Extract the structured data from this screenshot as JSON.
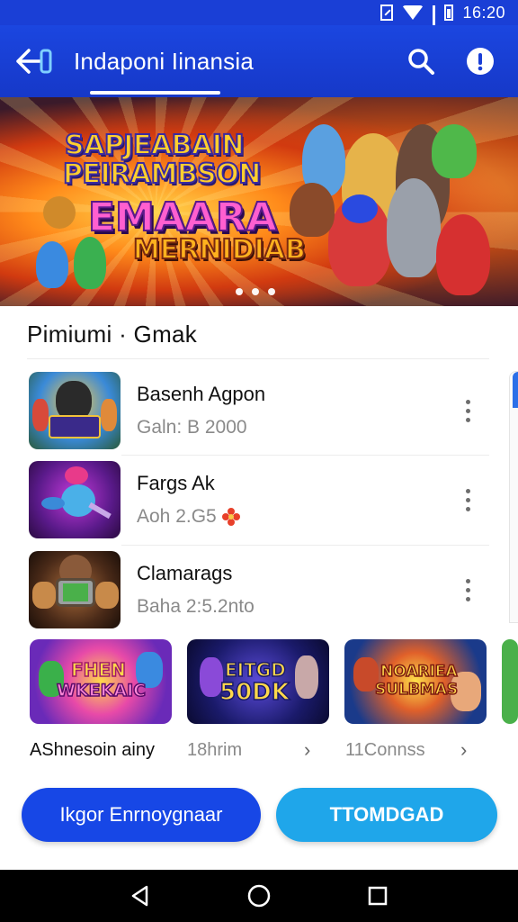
{
  "status_bar": {
    "time": "16:20",
    "icons": [
      "sim-icon",
      "wifi-icon",
      "signal-icon",
      "battery-icon"
    ]
  },
  "app_bar": {
    "title": "Indaponi Iinansia",
    "back_icon": "back-arrow-icon",
    "search_icon": "search-icon",
    "info_icon": "info-icon"
  },
  "banner": {
    "line1": "SAPJEABAIN",
    "line2": "PEIRAMBSON",
    "line3": "EMAARA",
    "line4": "MERNIDIAB",
    "pages": 3
  },
  "section": {
    "title": "Pimiumi · Gmak"
  },
  "list": [
    {
      "title": "Basenh Agpon",
      "subtitle": "Galn: B 2000"
    },
    {
      "title": "Fargs Ak",
      "subtitle": "Aoh 2.G5"
    },
    {
      "title": "Clamarags",
      "subtitle": "Baha 2:5.2nto"
    }
  ],
  "cards": [
    {
      "art_line1": "FHEN",
      "art_line2": "WKEKAIC",
      "caption": "AShnesoin ainy"
    },
    {
      "art_line1": "EITGD",
      "art_line2": "50DK",
      "caption": "18hrim"
    },
    {
      "art_line1": "NOARIEA",
      "art_line2": "SULBMAS",
      "caption": "11Connss"
    }
  ],
  "buttons": {
    "primary": "Ikgor Enrnoygnaar",
    "secondary": "TTOMDGAD"
  },
  "nav": {
    "back": "triangle-back-icon",
    "home": "circle-home-icon",
    "recents": "square-recents-icon"
  },
  "colors": {
    "app_bar": "#1a3fd6",
    "primary_button": "#1747e6",
    "secondary_button": "#1fa6ea"
  }
}
